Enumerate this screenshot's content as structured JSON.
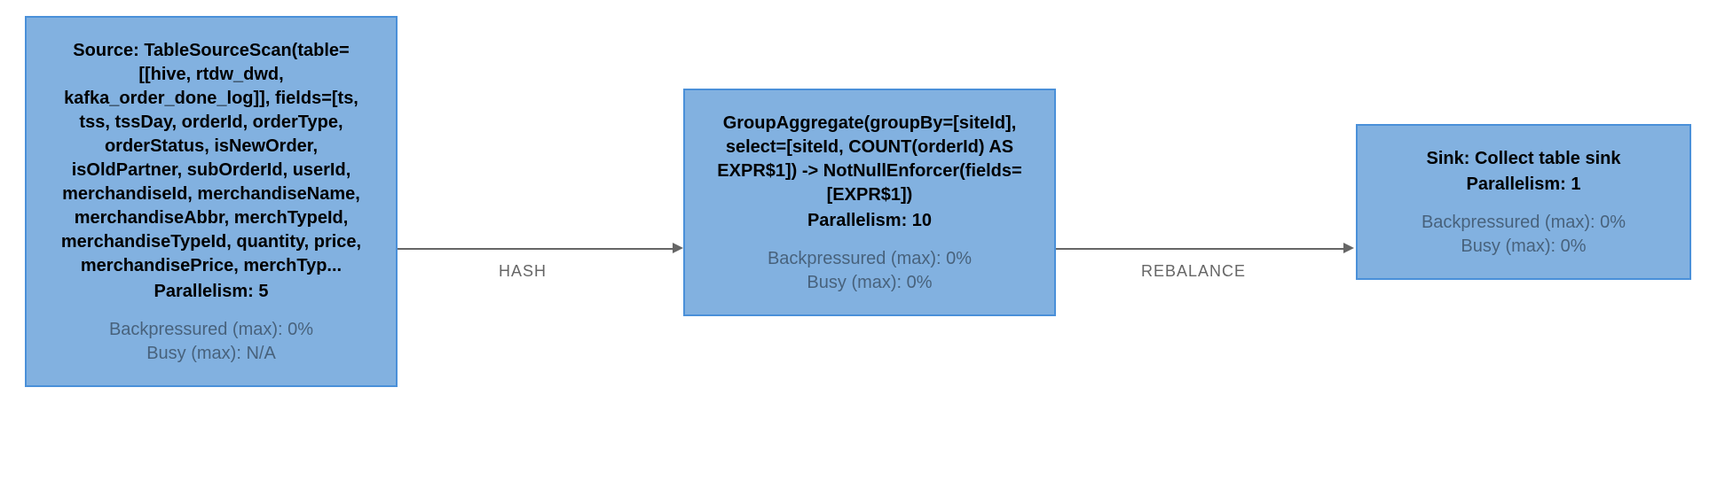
{
  "nodes": {
    "source": {
      "title": "Source: TableSourceScan(table=[[hive, rtdw_dwd, kafka_order_done_log]], fields=[ts, tss, tssDay, orderId, orderType, orderStatus, isNewOrder, isOldPartner, subOrderId, userId, merchandiseId, merchandiseName, merchandiseAbbr, merchTypeId, merchandiseTypeId, quantity, price, merchandisePrice, merchTyp...",
      "parallelism_label": "Parallelism: 5",
      "backpressure": "Backpressured (max): 0%",
      "busy": "Busy (max): N/A"
    },
    "agg": {
      "title": "GroupAggregate(groupBy=[siteId], select=[siteId, COUNT(orderId) AS EXPR$1]) -> NotNullEnforcer(fields=[EXPR$1])",
      "parallelism_label": "Parallelism: 10",
      "backpressure": "Backpressured (max): 0%",
      "busy": "Busy (max): 0%"
    },
    "sink": {
      "title": "Sink: Collect table sink",
      "parallelism_label": "Parallelism: 1",
      "backpressure": "Backpressured (max): 0%",
      "busy": "Busy (max): 0%"
    }
  },
  "edges": {
    "e1": {
      "label": "HASH"
    },
    "e2": {
      "label": "REBALANCE"
    }
  }
}
